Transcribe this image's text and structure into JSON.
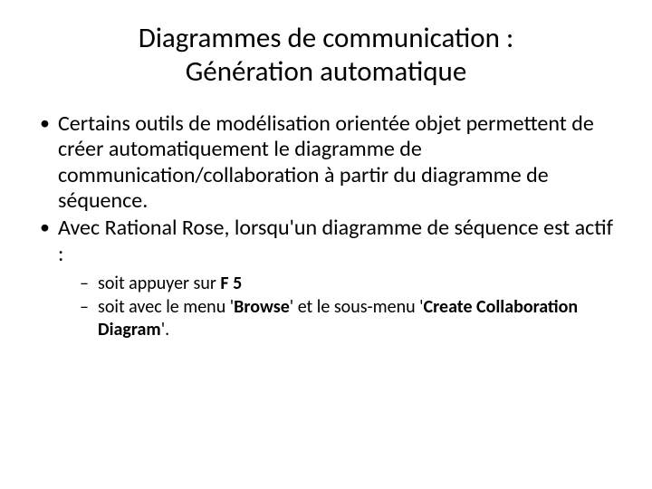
{
  "title_line1": "Diagrammes de communication :",
  "title_line2": "Génération automatique",
  "bullets": {
    "b1": "Certains outils de modélisation orientée objet permettent de créer automatiquement le diagramme de communication/collaboration à partir du diagramme de séquence.",
    "b2": "Avec Rational Rose, lorsqu'un diagramme de séquence est actif :"
  },
  "sub": {
    "s1_pre": "soit appuyer sur ",
    "s1_bold": "F 5",
    "s2_pre": "soit avec le menu ",
    "s2_q1": "'",
    "s2_b1": "Browse",
    "s2_mid": "' et le sous-menu '",
    "s2_b2": "Create Collaboration Diagram",
    "s2_end": "'."
  }
}
